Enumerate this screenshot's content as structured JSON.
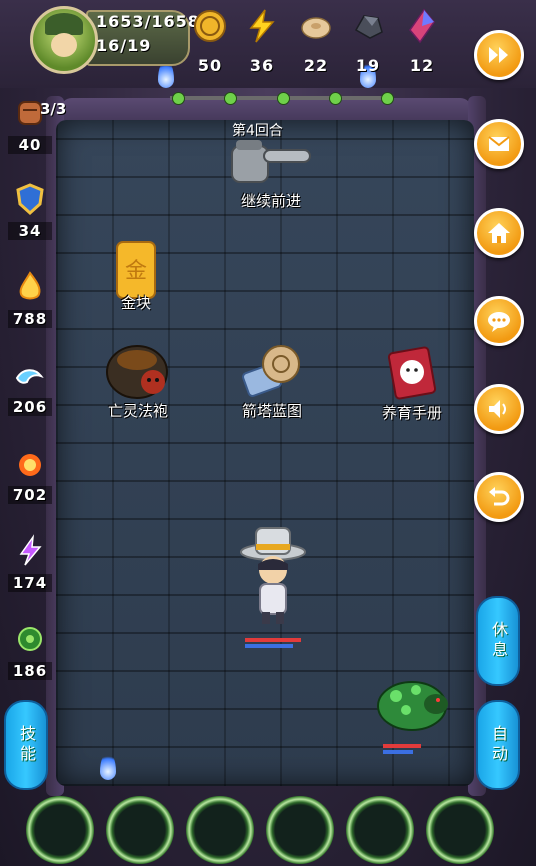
{
  "player": {
    "hp": "1653/1658",
    "level": "16/19"
  },
  "resources": [
    {
      "icon": "gold-coin-icon",
      "value": "50"
    },
    {
      "icon": "lightning-icon",
      "value": "36"
    },
    {
      "icon": "bread-icon",
      "value": "22"
    },
    {
      "icon": "ore-icon",
      "value": "19"
    },
    {
      "icon": "crystal-icon",
      "value": "12"
    }
  ],
  "round": "第4回合",
  "continue_label": "继续前进",
  "left_stats": [
    {
      "icon": "fist-icon",
      "value": "40",
      "extra": "3/3"
    },
    {
      "icon": "shield-icon",
      "value": "34"
    },
    {
      "icon": "fire-spirit-icon",
      "value": "788"
    },
    {
      "icon": "water-wave-icon",
      "value": "206"
    },
    {
      "icon": "fireball-icon",
      "value": "702"
    },
    {
      "icon": "lightning-rune-icon",
      "value": "174"
    },
    {
      "icon": "poison-claw-icon",
      "value": "186"
    }
  ],
  "floor_items": {
    "gold": "金块",
    "robe": "亡灵法袍",
    "blueprint": "箭塔蓝图",
    "manual": "养育手册"
  },
  "gold_symbol": "金",
  "side_buttons": {
    "skill": "技能",
    "rest": "休息",
    "auto": "自动"
  },
  "colors": {
    "accent_orange": "#f29a12",
    "pill_blue": "#1aa6e8",
    "hp_red": "#e23b3b"
  }
}
